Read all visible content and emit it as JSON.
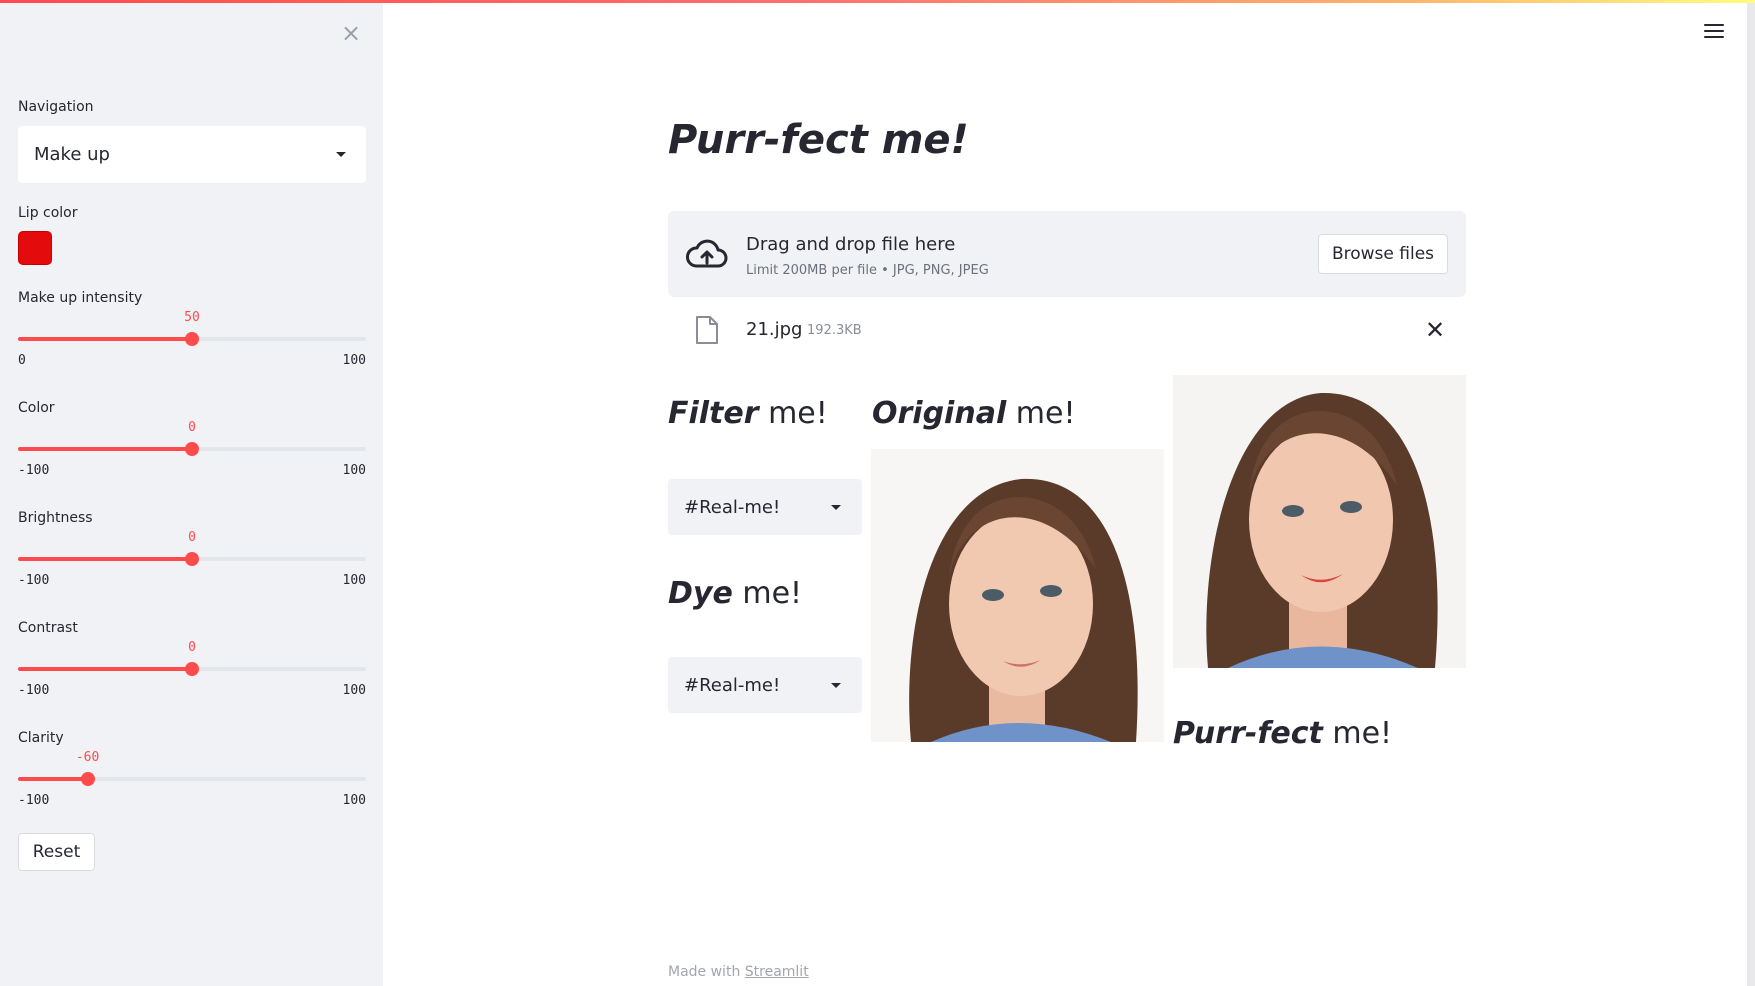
{
  "sidebar": {
    "navigation": {
      "label": "Navigation",
      "value": "Make up"
    },
    "lip_color": {
      "label": "Lip color",
      "color": "#e30b0b"
    },
    "sliders": [
      {
        "label": "Make up intensity",
        "value": 50,
        "min": 0,
        "max": 100,
        "value_text": "50",
        "min_text": "0",
        "max_text": "100"
      },
      {
        "label": "Color",
        "value": 0,
        "min": -100,
        "max": 100,
        "value_text": "0",
        "min_text": "-100",
        "max_text": "100"
      },
      {
        "label": "Brightness",
        "value": 0,
        "min": -100,
        "max": 100,
        "value_text": "0",
        "min_text": "-100",
        "max_text": "100"
      },
      {
        "label": "Contrast",
        "value": 0,
        "min": -100,
        "max": 100,
        "value_text": "0",
        "min_text": "-100",
        "max_text": "100"
      },
      {
        "label": "Clarity",
        "value": -60,
        "min": -100,
        "max": 100,
        "value_text": "-60",
        "min_text": "-100",
        "max_text": "100"
      }
    ],
    "reset_label": "Reset"
  },
  "main": {
    "title": "Purr-fect me!",
    "uploader": {
      "drop_text": "Drag and drop file here",
      "limit_text": "Limit 200MB per file • JPG, PNG, JPEG",
      "browse_label": "Browse files"
    },
    "file": {
      "name": "21.jpg",
      "size": "192.3KB"
    },
    "filter": {
      "bold": "Filter",
      "rest": " me!",
      "select_value": "#Real-me!"
    },
    "dye": {
      "bold": "Dye",
      "rest": " me!",
      "select_value": "#Real-me!"
    },
    "original": {
      "bold": "Original",
      "rest": " me!"
    },
    "purrfect": {
      "bold": "Purr-fect",
      "rest": " me!"
    }
  },
  "footer": {
    "prefix": "Made with ",
    "link": "Streamlit"
  },
  "colors": {
    "accent": "#ff4b4b",
    "sidebar_bg": "#f0f2f6",
    "text": "#262730"
  }
}
